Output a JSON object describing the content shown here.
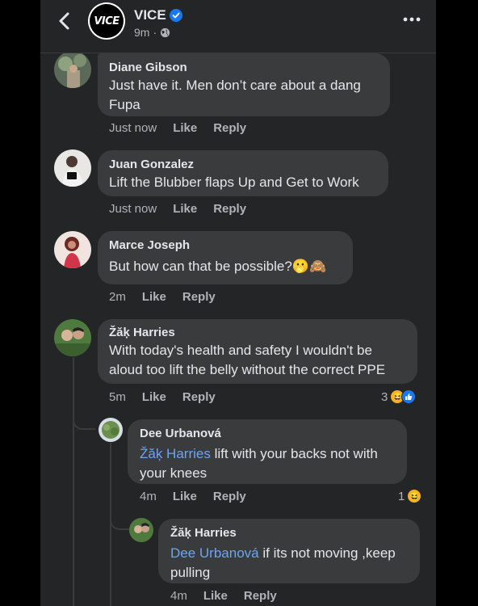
{
  "header": {
    "page_name": "VICE",
    "logo_text": "VICE",
    "time": "9m",
    "separator": "·"
  },
  "comments": [
    {
      "author": "Diane Gibson",
      "text": "Just have it. Men don’t care about a dang Fupa",
      "time": "Just now",
      "like": "Like",
      "reply": "Reply"
    },
    {
      "author": "Juan Gonzalez",
      "text": "Lift the Blubber flaps Up and Get to Work",
      "time": "Just now",
      "like": "Like",
      "reply": "Reply"
    },
    {
      "author": "Marce Joseph",
      "text": "But how can that be possible?",
      "emojis": "🫢🙈",
      "time": "2m",
      "like": "Like",
      "reply": "Reply"
    },
    {
      "author": "Žăķ Harries",
      "text": "With today's health and safety I wouldn't be aloud too lift the belly without the correct PPE",
      "time": "5m",
      "like": "Like",
      "reply": "Reply",
      "reaction_count": "3"
    },
    {
      "author": "Dee Urbanová",
      "mention": "Žăķ Harries",
      "text": " lift with your backs not with your knees",
      "time": "4m",
      "like": "Like",
      "reply": "Reply",
      "reaction_count": "1"
    },
    {
      "author": "Žăķ Harries",
      "mention": "Dee Urbanová",
      "text": " if its not moving ,keep pulling",
      "time": "4m",
      "like": "Like",
      "reply": "Reply"
    }
  ],
  "colors": {
    "background": "#242526",
    "bubble": "#3a3b3c",
    "mention": "#6ba5f3",
    "verified": "#1877f2"
  }
}
